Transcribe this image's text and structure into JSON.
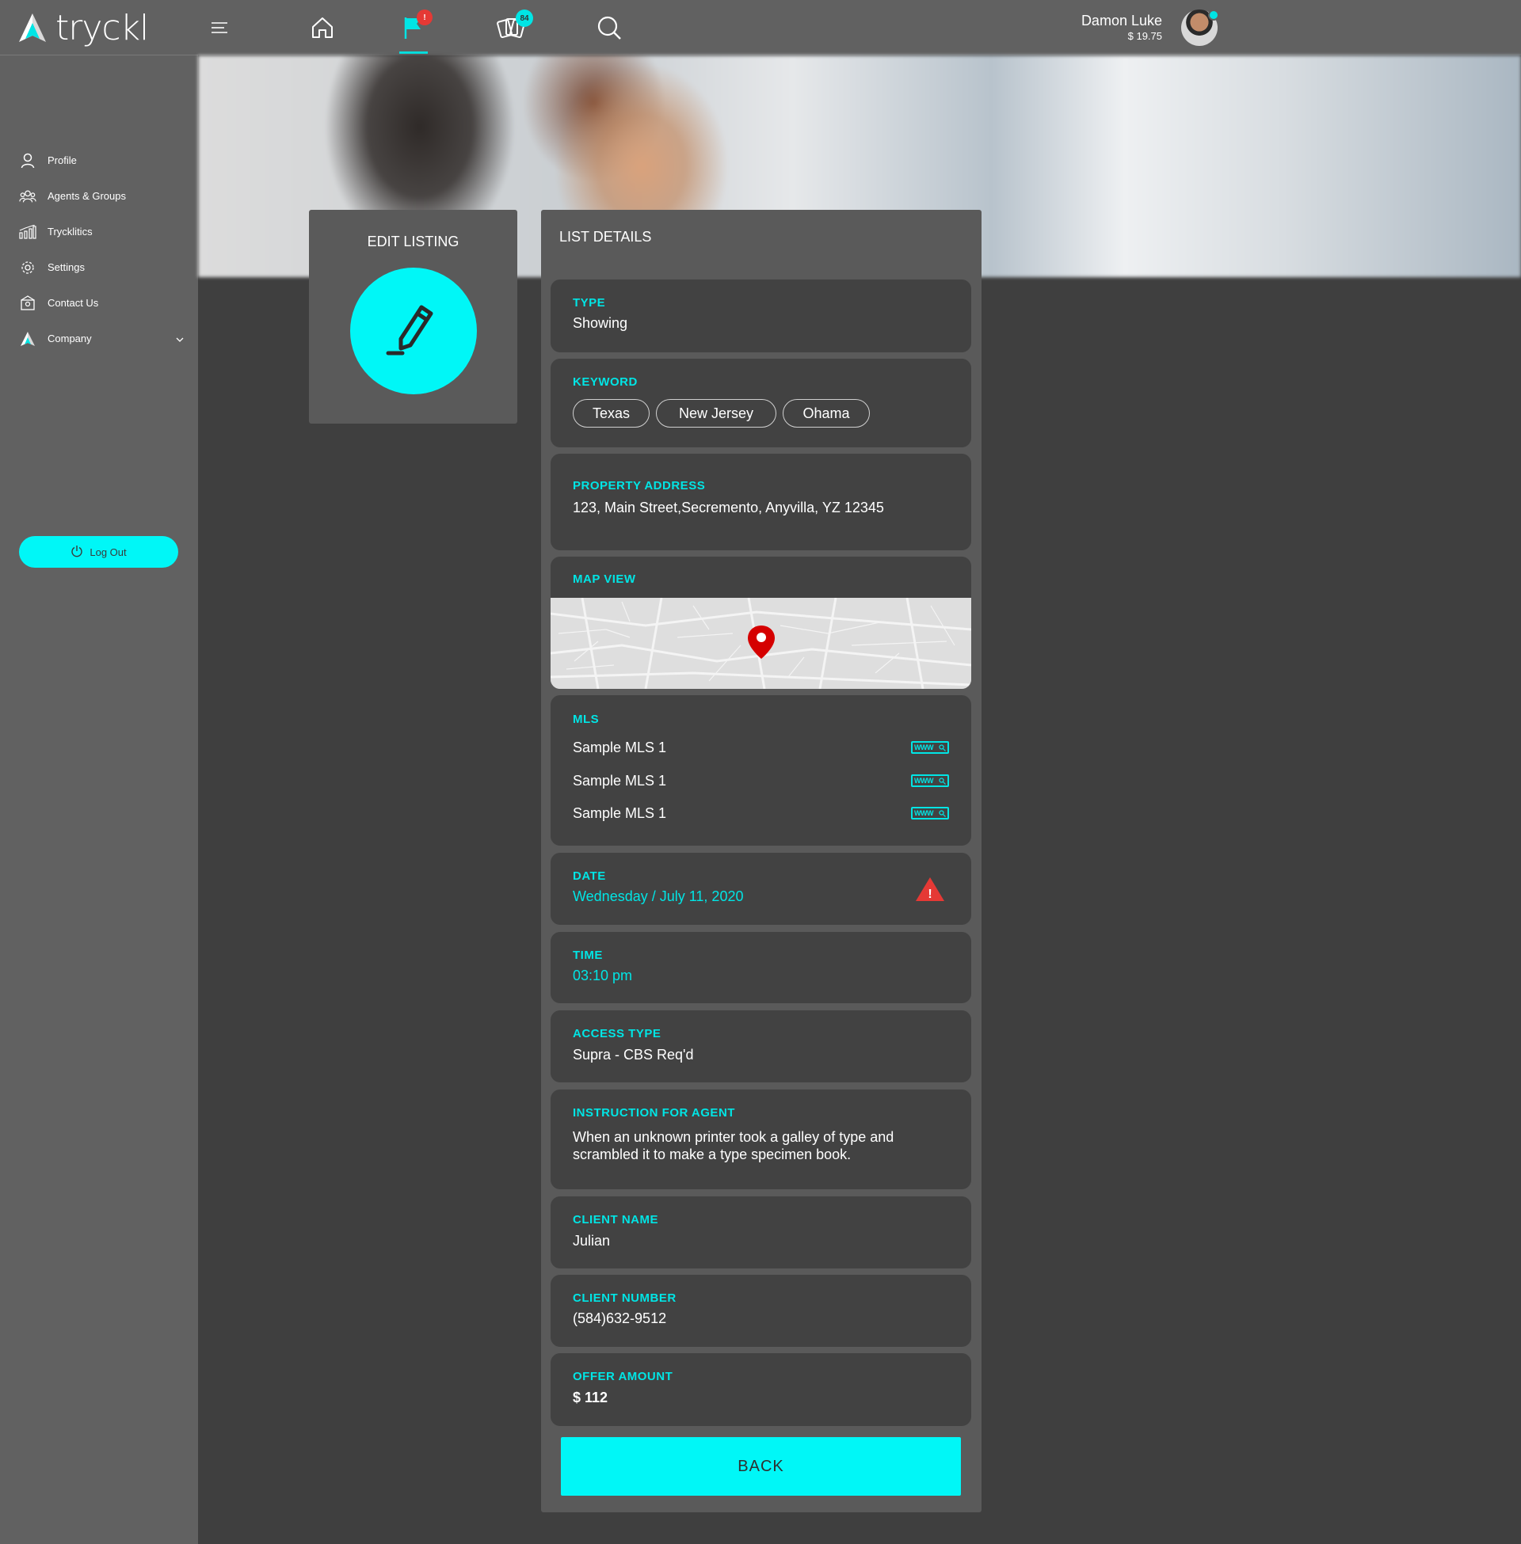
{
  "brand": {
    "name": "tryckl"
  },
  "sidebar": {
    "items": [
      {
        "label": "Profile",
        "icon": "user-icon"
      },
      {
        "label": "Agents & Groups",
        "icon": "group-icon"
      },
      {
        "label": "Trycklitics",
        "icon": "chart-icon"
      },
      {
        "label": "Settings",
        "icon": "gear-icon"
      },
      {
        "label": "Contact Us",
        "icon": "contact-icon"
      },
      {
        "label": "Company",
        "icon": "company-logo-icon",
        "expandable": true
      }
    ],
    "logout_label": "Log Out"
  },
  "topbar": {
    "icons": [
      "menu-icon",
      "home-icon",
      "flag-icon",
      "cards-icon",
      "search-icon"
    ],
    "active_icon": "flag-icon",
    "flag_badge": "!",
    "cards_badge": "84",
    "user": {
      "name": "Damon Luke",
      "balance": "$ 19.75",
      "online": true
    }
  },
  "edit_card": {
    "title": "EDIT LISTING"
  },
  "details": {
    "title": "LIST DETAILS",
    "type": {
      "label": "TYPE",
      "value": "Showing"
    },
    "keyword": {
      "label": "KEYWORD",
      "chips": [
        "Texas",
        "New Jersey",
        "Ohama"
      ]
    },
    "property_address": {
      "label": "PROPERTY ADDRESS",
      "value": "123, Main Street,Secremento, Anyvilla, YZ 12345"
    },
    "map_view": {
      "label": "MAP VIEW"
    },
    "mls": {
      "label": "MLS",
      "items": [
        "Sample MLS 1",
        "Sample MLS 1",
        "Sample MLS 1"
      ]
    },
    "date": {
      "label": "DATE",
      "value": "Wednesday / July 11, 2020",
      "warning": true
    },
    "time": {
      "label": "TIME",
      "value": "03:10 pm"
    },
    "access_type": {
      "label": "ACCESS TYPE",
      "value": "Supra - CBS Req'd"
    },
    "instruction": {
      "label": "INSTRUCTION FOR AGENT",
      "value": "When an unknown printer took a galley of type and scrambled it to make a type specimen book."
    },
    "client_name": {
      "label": "CLIENT NAME",
      "value": "Julian"
    },
    "client_number": {
      "label": "CLIENT NUMBER",
      "value": "(584)632-9512"
    },
    "offer_amount": {
      "label": "OFFER AMOUNT",
      "value": "$ 112"
    },
    "back_label": "BACK"
  },
  "colors": {
    "accent": "#00f7f7",
    "accent_text": "#00e5e5",
    "alert": "#e53935",
    "sidebar": "#616161",
    "background": "#3f3f3f",
    "card": "#5a5a5a",
    "field": "#424242"
  }
}
